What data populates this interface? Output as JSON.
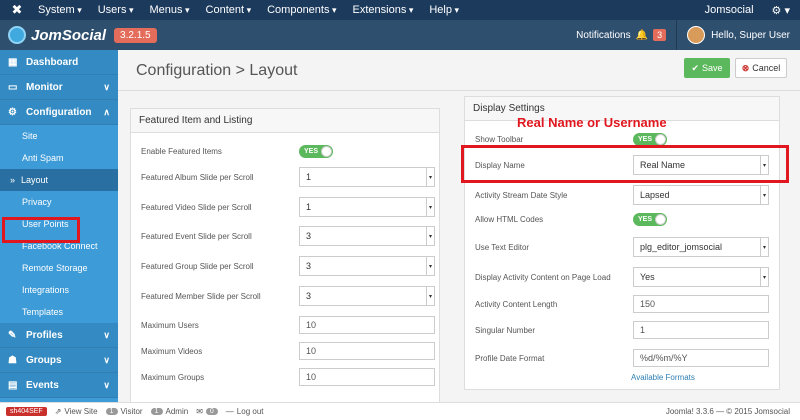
{
  "topbar": {
    "menu": [
      "System",
      "Users",
      "Menus",
      "Content",
      "Components",
      "Extensions",
      "Help"
    ],
    "site_name": "Jomsocial",
    "settings_icon": "gear-icon"
  },
  "brand": {
    "name": "JomSocial",
    "version": "3.2.1.5",
    "notifications_label": "Notifications",
    "notifications_count": "3",
    "user_label": "Hello, Super User"
  },
  "sidebar": {
    "dashboard": "Dashboard",
    "monitor": "Monitor",
    "configuration": "Configuration",
    "config_items": [
      "Site",
      "Anti Spam",
      "Layout",
      "Privacy",
      "User Points",
      "Facebook Connect",
      "Remote Storage",
      "Integrations",
      "Templates"
    ],
    "profiles": "Profiles",
    "groups": "Groups",
    "events": "Events"
  },
  "page": {
    "title": "Configuration > Layout",
    "save_label": "Save",
    "cancel_label": "Cancel"
  },
  "featured": {
    "heading": "Featured Item and Listing",
    "enable_label": "Enable Featured Items",
    "toggle_yes": "YES",
    "rows": [
      {
        "label": "Featured Album Slide per Scroll",
        "value": "1"
      },
      {
        "label": "Featured Video Slide per Scroll",
        "value": "1"
      },
      {
        "label": "Featured Event Slide per Scroll",
        "value": "3"
      },
      {
        "label": "Featured Group Slide per Scroll",
        "value": "3"
      },
      {
        "label": "Featured Member Slide per Scroll",
        "value": "3"
      }
    ],
    "inputs": [
      {
        "label": "Maximum Users",
        "value": "10"
      },
      {
        "label": "Maximum Videos",
        "value": "10"
      },
      {
        "label": "Maximum Groups",
        "value": "10"
      }
    ]
  },
  "display": {
    "heading": "Display Settings",
    "annotation": "Real Name or Username",
    "show_toolbar": "Show Toolbar",
    "display_name_label": "Display Name",
    "display_name_value": "Real Name",
    "date_style_label": "Activity Stream Date Style",
    "date_style_value": "Lapsed",
    "html_codes_label": "Allow HTML Codes",
    "editor_label": "Use Text Editor",
    "editor_value": "plg_editor_jomsocial",
    "page_load_label": "Display Activity Content on Page Load",
    "page_load_value": "Yes",
    "content_length_label": "Activity Content Length",
    "content_length_value": "150",
    "singular_label": "Singular Number",
    "singular_value": "1",
    "date_format_label": "Profile Date Format",
    "date_format_value": "%d/%m/%Y",
    "available_formats": "Available Formats",
    "toggle_yes": "YES"
  },
  "footer": {
    "tag": "sh404SEF",
    "view_site": "View Site",
    "visitor_count": "1",
    "visitor_label": "Visitor",
    "admin_count": "1",
    "admin_label": "Admin",
    "messages_count": "0",
    "logout": "Log out",
    "version": "Joomla! 3.3.6 — © 2015 Jomsocial"
  }
}
